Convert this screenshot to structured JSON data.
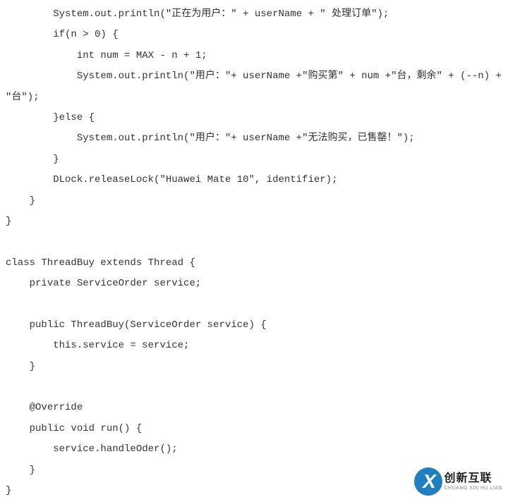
{
  "code": {
    "lines": [
      "        System.out.println(\"正在为用户：\" + userName + \" 处理订单\");",
      "        if(n > 0) {",
      "            int num = MAX - n + 1;",
      "            System.out.println(\"用户：\"+ userName +\"购买第\" + num +\"台，剩余\" + (--n) + \"台\");",
      "        }else {",
      "            System.out.println(\"用户：\"+ userName +\"无法购买，已售罄！\");",
      "        }",
      "        DLock.releaseLock(\"Huawei Mate 10\", identifier);",
      "    }",
      "}",
      "",
      "class ThreadBuy extends Thread {",
      "    private ServiceOrder service;",
      "",
      "    public ThreadBuy(ServiceOrder service) {",
      "        this.service = service;",
      "    }",
      "",
      "    @Override",
      "    public void run() {",
      "        service.handleOder();",
      "    }",
      "}"
    ]
  },
  "logo": {
    "mark": "X",
    "cn": "创新互联",
    "en": "CHUANG XIN HU LIAN"
  }
}
